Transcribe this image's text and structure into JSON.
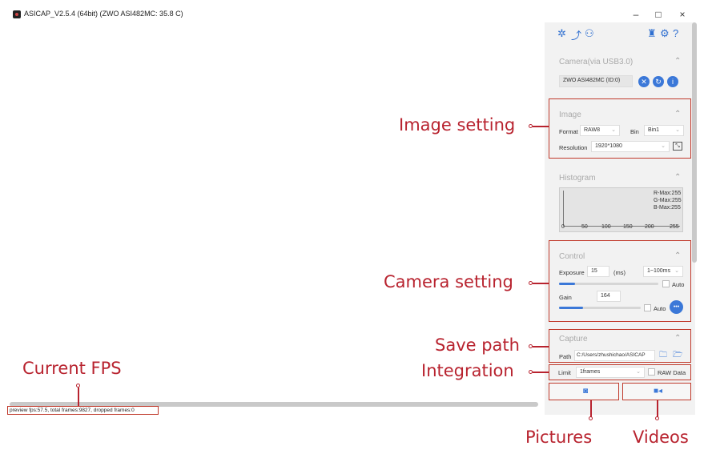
{
  "window": {
    "title": "ASICAP_V2.5.4 (64bit) (ZWO ASI482MC: 35.8 C)",
    "minimize": "–",
    "maximize": "□",
    "close": "×"
  },
  "toolbar": {
    "icons": [
      "settings-wheel-icon",
      "telescope-icon",
      "user-icon",
      "shirt-icon",
      "gear-icon",
      "help-icon"
    ]
  },
  "camera": {
    "title": "Camera(via USB3.0)",
    "device": "ZWO ASI482MC (ID:0)"
  },
  "image": {
    "title": "Image",
    "format_label": "Format",
    "format_value": "RAW8",
    "bin_label": "Bin",
    "bin_value": "Bin1",
    "resolution_label": "Resolution",
    "resolution_value": "1920*1080"
  },
  "histogram": {
    "title": "Histogram",
    "r_max": "R-Max:255",
    "g_max": "G-Max:255",
    "b_max": "B-Max:255",
    "ticks": [
      "0",
      "50",
      "100",
      "150",
      "200",
      "255"
    ]
  },
  "control": {
    "title": "Control",
    "exposure_label": "Exposure",
    "exposure_value": "15",
    "exposure_unit": "(ms)",
    "exposure_range": "1~100ms",
    "auto_label": "Auto",
    "gain_label": "Gain",
    "gain_value": "164",
    "gain_auto_label": "Auto",
    "more": "•••"
  },
  "capture": {
    "title": "Capture",
    "path_label": "Path",
    "path_value": "C:/Users/zhushichao/ASICAP"
  },
  "limit": {
    "label": "Limit",
    "value": "1frames",
    "raw_data_label": "RAW Data"
  },
  "status": {
    "text": "preview fps:57.5, total frames:9827, dropped frames:0"
  },
  "annotations": {
    "image_setting": "Image setting",
    "camera_setting": "Camera setting",
    "save_path": "Save path",
    "integration": "Integration",
    "current_fps": "Current FPS",
    "pictures": "Pictures",
    "videos": "Videos"
  },
  "colors": {
    "accent": "#3b78d8",
    "annotation": "#b8232f",
    "panel_bg": "#f2f2f2"
  }
}
